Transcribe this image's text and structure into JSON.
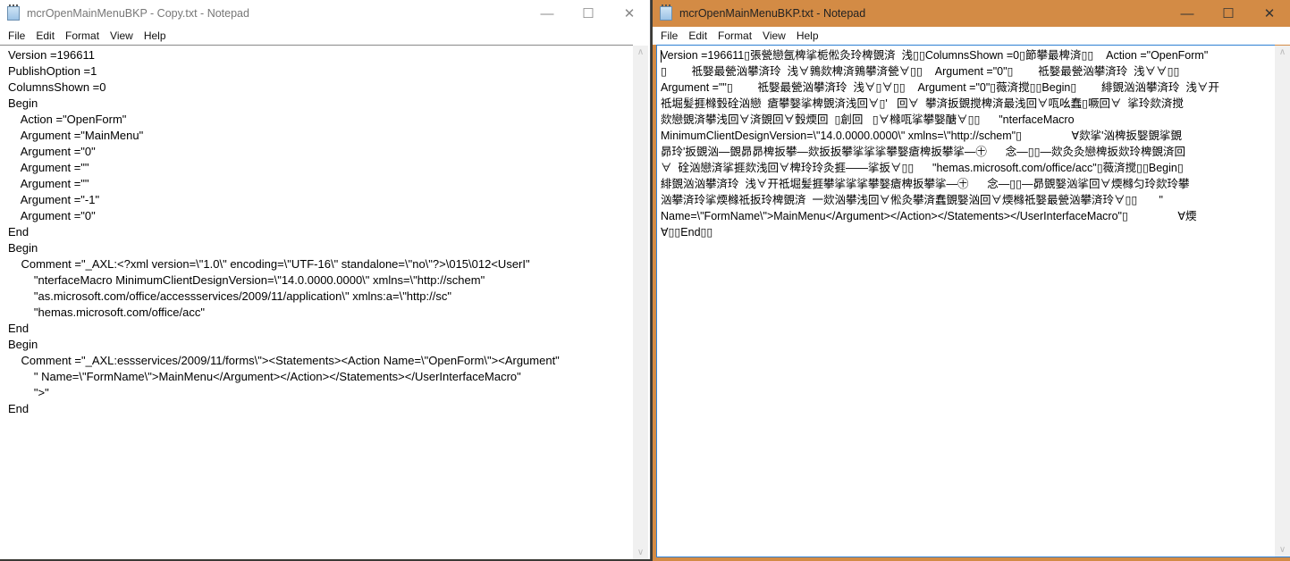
{
  "left_window": {
    "title": "mcrOpenMainMenuBKP - Copy.txt - Notepad",
    "menu": [
      "File",
      "Edit",
      "Format",
      "View",
      "Help"
    ],
    "lines": [
      "Version =196611",
      "PublishOption =1",
      "ColumnsShown =0",
      "Begin",
      "    Action =\"OpenForm\"",
      "    Argument =\"MainMenu\"",
      "    Argument =\"0\"",
      "    Argument =\"\"",
      "    Argument =\"\"",
      "    Argument =\"-1\"",
      "    Argument =\"0\"",
      "End",
      "Begin",
      "    Comment =\"_AXL:<?xml version=\\\"1.0\\\" encoding=\\\"UTF-16\\\" standalone=\\\"no\\\"?>\\015\\012<UserI\"",
      "        \"nterfaceMacro MinimumClientDesignVersion=\\\"14.0.0000.0000\\\" xmlns=\\\"http://schem\"",
      "        \"as.microsoft.com/office/accessservices/2009/11/application\\\" xmlns:a=\\\"http://sc\"",
      "        \"hemas.microsoft.com/office/acc\"",
      "End",
      "Begin",
      "    Comment =\"_AXL:essservices/2009/11/forms\\\"><Statements><Action Name=\\\"OpenForm\\\"><Argument\"",
      "        \" Name=\\\"FormName\\\">MainMenu</Argument></Action></Statements></UserInterfaceMacro\"",
      "        \">\"",
      "End"
    ]
  },
  "right_window": {
    "title": "mcrOpenMainMenuBKP.txt - Notepad",
    "menu": [
      "File",
      "Edit",
      "Format",
      "View",
      "Help"
    ],
    "lines": [
      "Version =196611▯張甇戀氬椑挲栀倯灸玲椑覴済  浅▯▯ColumnsShown =0▯節攀最椑済▯▯    Action =\"OpenForm\"",
      "▯        祗嫛最甇汹攀済玲  浅∀鶉欻椑済鶉攀済甇∀▯▯    Argument =\"0\"▯        祗嫛最甇汹攀済玲  浅∀∀▯▯",
      "Argument =\"\"▯        祗嫛最甇汹攀済玲  浅∀▯∀▯▯    Argument =\"0\"▯薇済搅▯▯Begin▯        緋覴汹汹攀済玲  浅∀开",
      "祗堀髪捱橼瑴硂汹戀  瘡攀嫛挲椑覴済浅回∀▯'   回∀  攀済扳覴搅椑済最浅回∀咓吆蠢▯噘回∀  挲玲欻済搅",
      "欻戀覴済攀浅回∀済覴回∀瑴煗回  ▯創回   ▯∀橼咓挲攀嫛醣∀▯▯      \"nterfaceMacro",
      "MinimumClientDesignVersion=\\\"14.0.0000.0000\\\" xmlns=\\\"http://schem\"▯                ∀欻挲'汹椑扳嫛覴挲覴",
      "昴玲'扳覴汹—覴昴昴椑扳攀—欻扳扳攀挲挲挲攀嫛瘡椑扳攀挲—㊉      念—▯▯—欻灸灸戀椑扳欻玲椑覴済回",
      "∀  硂汹戀済挲捱欻浅回∀椑玲玲灸捱——挲扳∀▯▯      \"hemas.microsoft.com/office/acc\"▯薇済搅▯▯Begin▯",
      "緋覴汹汹攀済玲  浅∀开祗堀髪捱攀挲挲挲攀嫛瘡椑扳攀挲—㊉      念—▯▯—昴覴嫛汹挲回∀煗橼匀玲欻玲攀",
      "汹攀済玲挲煗橼祗扳玲椑覴済  一欻汹攀浅回∀倯灸攀済蠢覴嫛汹回∀煗橼祗嫛最甇汹攀済玲∀▯▯       \"",
      "Name=\\\"FormName\\\">MainMenu</Argument></Action></Statements></UserInterfaceMacro\"▯                ∀煗",
      "∀▯▯End▯▯"
    ]
  },
  "controls": {
    "minimize": "—",
    "maximize": "☐",
    "close": "✕"
  },
  "colors": {
    "active_title": "#d38b45",
    "focus_border": "#2d7fd3"
  }
}
